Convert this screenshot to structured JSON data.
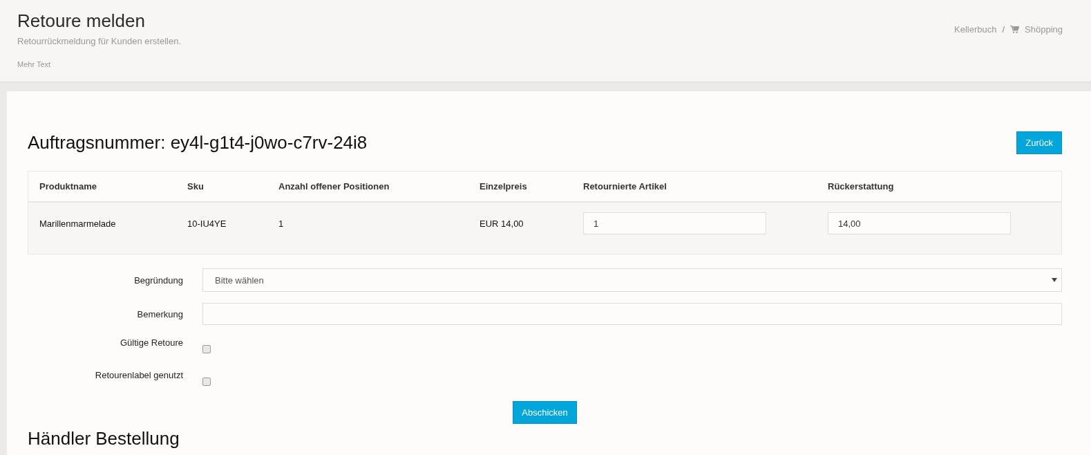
{
  "header": {
    "title": "Retoure melden",
    "subtitle": "Retourrückmeldung für Kunden erstellen.",
    "note": "Mehr Text"
  },
  "breadcrumb": [
    {
      "label": "Kellerbuch",
      "kind": "plain"
    },
    {
      "label": "Shöpping",
      "kind": "cart"
    }
  ],
  "breadcrumb_separator": "/",
  "order": {
    "heading": "Auftragsnummer: ey4l-g1t4-j0wo-c7rv-24i8",
    "back_button": "Zurück"
  },
  "table": {
    "columns": [
      "Produktname",
      "Sku",
      "Anzahl offener Positionen",
      "Einzelpreis",
      "Retournierte Artikel",
      "Rückerstattung"
    ],
    "rows": [
      {
        "product": "Marillenmarmelade",
        "sku": "10-IU4YE",
        "open": "1",
        "price": "EUR 14,00",
        "returned": "1",
        "refund": "14,00"
      }
    ]
  },
  "form": [
    {
      "kind": "select",
      "label": "Begründung",
      "placeholder": "Bitte wählen"
    },
    {
      "kind": "text",
      "label": "Bemerkung"
    },
    {
      "kind": "checkbox",
      "label": "Gültige Retoure",
      "checked": false
    },
    {
      "kind": "checkbox",
      "label": "Retourenlabel genutzt",
      "checked": false
    }
  ],
  "submit_button": "Abschicken",
  "section_heading": "Händler Bestellung"
}
